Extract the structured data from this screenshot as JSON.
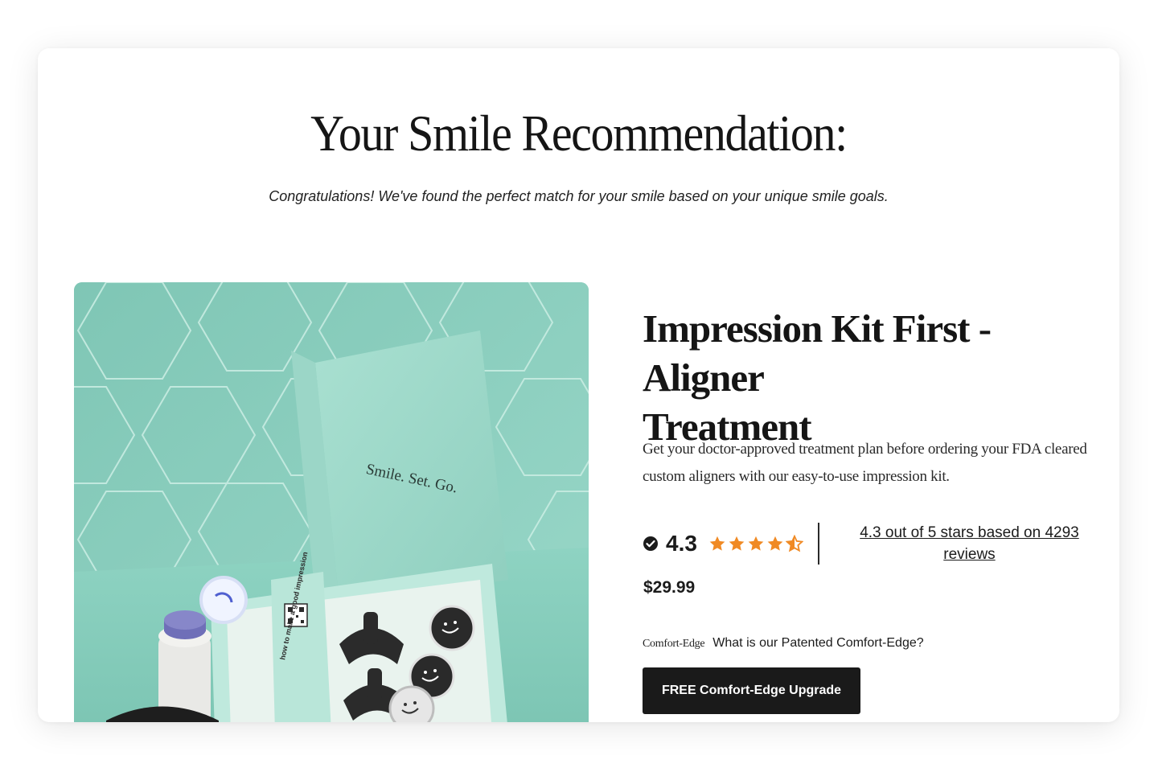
{
  "page": {
    "title": "Your Smile Recommendation:",
    "subtitle": "Congratulations! We've found the perfect match for your smile based on your unique smile goals."
  },
  "product": {
    "image_box_text": "Smile. Set. Go.",
    "image_card_text": "how to make a good impression",
    "title_line1": "Impression Kit First - Aligner",
    "title_line2": "Treatment",
    "description": "Get your doctor-approved treatment plan before ordering your FDA cleared custom aligners with our easy-to-use impression kit.",
    "rating": {
      "value": "4.3",
      "stars_filled": 4.5,
      "stars_total": 5,
      "star_color": "#f08a24",
      "icon": "verified-check-icon",
      "reviews_text": "4.3 out of 5 stars based on 4293 reviews"
    },
    "price": "$29.99",
    "comfort": {
      "logo_text": "Comfort-Edge",
      "link_text": "What is our Patented Comfort-Edge?"
    },
    "cta_label": "FREE Comfort-Edge Upgrade"
  },
  "colors": {
    "accent_dark": "#1a1a1a",
    "teal": "#8fd0c1",
    "star": "#f08a24"
  }
}
